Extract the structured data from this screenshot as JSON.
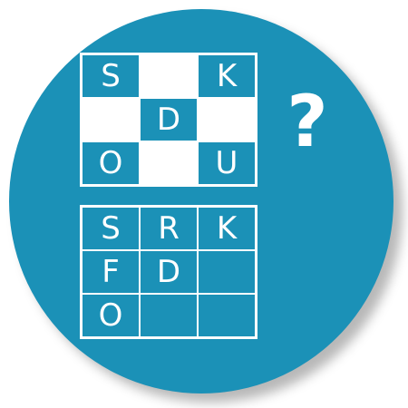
{
  "colors": {
    "disc": "#1b91b7",
    "foreground": "#ffffff"
  },
  "top_grid": {
    "cells": [
      {
        "text": "S",
        "filled": false
      },
      {
        "text": "",
        "filled": true
      },
      {
        "text": "K",
        "filled": false
      },
      {
        "text": "",
        "filled": true
      },
      {
        "text": "D",
        "filled": false
      },
      {
        "text": "",
        "filled": true
      },
      {
        "text": "O",
        "filled": false
      },
      {
        "text": "",
        "filled": true
      },
      {
        "text": "U",
        "filled": false
      }
    ]
  },
  "question_mark": "?",
  "bottom_grid": {
    "cells": [
      {
        "text": "S",
        "filled": false
      },
      {
        "text": "R",
        "filled": false
      },
      {
        "text": "K",
        "filled": false
      },
      {
        "text": "F",
        "filled": false
      },
      {
        "text": "D",
        "filled": false
      },
      {
        "text": "",
        "filled": false
      },
      {
        "text": "O",
        "filled": false
      },
      {
        "text": "",
        "filled": false
      },
      {
        "text": "",
        "filled": false
      }
    ]
  }
}
